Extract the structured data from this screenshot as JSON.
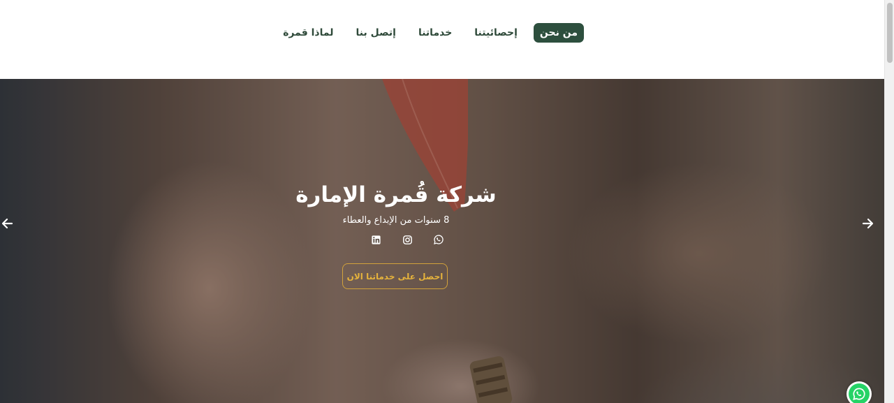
{
  "nav": {
    "items": [
      {
        "label": "من نحن",
        "active": true
      },
      {
        "label": "إحصائيتنا",
        "active": false
      },
      {
        "label": "خدماتنا",
        "active": false
      },
      {
        "label": "إتصل بنا",
        "active": false
      },
      {
        "label": "لماذا قمرة",
        "active": false
      }
    ]
  },
  "hero": {
    "title": "شركة قُمرة الإمارة",
    "subtitle": "8 سنوات من الإبداع والعطاء",
    "socials": [
      "linkedin-icon",
      "instagram-icon",
      "whatsapp-icon"
    ],
    "cta_label": "احصل على خدماتنا الان"
  },
  "colors": {
    "nav_active_bg": "#2d4f3e",
    "nav_text": "#2f4a3a",
    "cta_border": "#d2a23b",
    "cta_text": "#e6b33c",
    "whatsapp_green": "#25d366"
  }
}
